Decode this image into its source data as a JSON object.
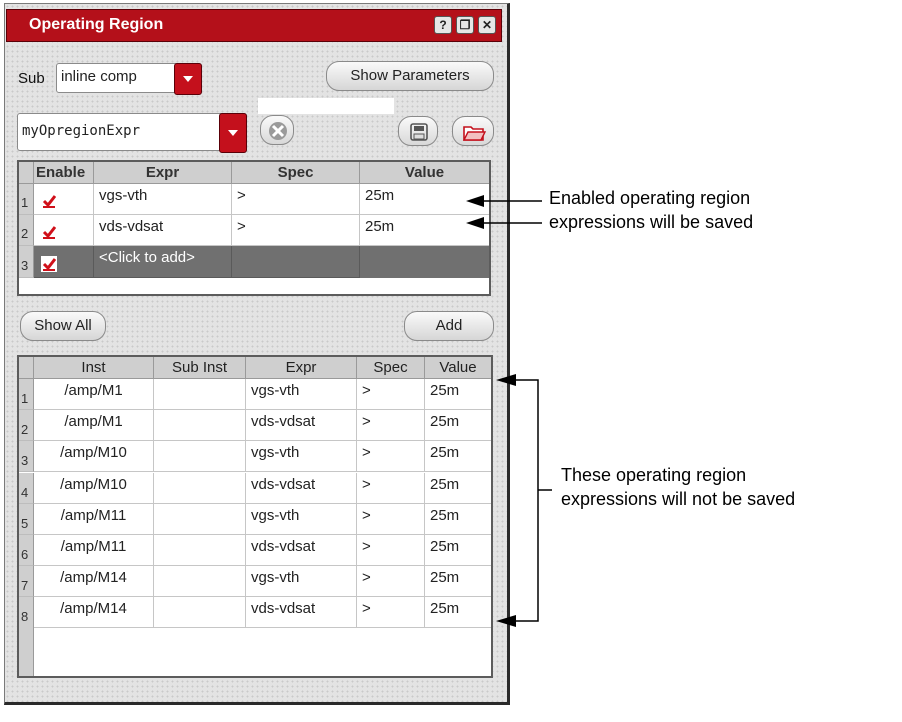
{
  "window": {
    "title": "Operating Region",
    "help_glyph": "?",
    "restore_glyph": "❐",
    "close_glyph": "✕"
  },
  "sub": {
    "label": "Sub",
    "selected": "inline comp"
  },
  "show_parameters_label": "Show Parameters",
  "expr_set_selected": "myOpregionExpr",
  "top_table": {
    "columns": [
      "Enable",
      "Expr",
      "Spec",
      "Value"
    ],
    "rows": [
      {
        "num": "1",
        "enabled": true,
        "expr": "vgs-vth",
        "spec": ">",
        "value": "25m"
      },
      {
        "num": "2",
        "enabled": true,
        "expr": "vds-vdsat",
        "spec": ">",
        "value": "25m"
      },
      {
        "num": "3",
        "enabled": true,
        "expr": "<Click to add>",
        "spec": "",
        "value": ""
      }
    ]
  },
  "show_all_label": "Show All",
  "add_label": "Add",
  "bottom_table": {
    "columns": [
      "Inst",
      "Sub Inst",
      "Expr",
      "Spec",
      "Value"
    ],
    "rows": [
      {
        "num": "1",
        "inst": "/amp/M1",
        "sub_inst": "",
        "expr": "vgs-vth",
        "spec": ">",
        "value": "25m"
      },
      {
        "num": "2",
        "inst": "/amp/M1",
        "sub_inst": "",
        "expr": "vds-vdsat",
        "spec": ">",
        "value": "25m"
      },
      {
        "num": "3",
        "inst": "/amp/M10",
        "sub_inst": "",
        "expr": "vgs-vth",
        "spec": ">",
        "value": "25m"
      },
      {
        "num": "4",
        "inst": "/amp/M10",
        "sub_inst": "",
        "expr": "vds-vdsat",
        "spec": ">",
        "value": "25m"
      },
      {
        "num": "5",
        "inst": "/amp/M11",
        "sub_inst": "",
        "expr": "vgs-vth",
        "spec": ">",
        "value": "25m"
      },
      {
        "num": "6",
        "inst": "/amp/M11",
        "sub_inst": "",
        "expr": "vds-vdsat",
        "spec": ">",
        "value": "25m"
      },
      {
        "num": "7",
        "inst": "/amp/M14",
        "sub_inst": "",
        "expr": "vgs-vth",
        "spec": ">",
        "value": "25m"
      },
      {
        "num": "8",
        "inst": "/amp/M14",
        "sub_inst": "",
        "expr": "vds-vdsat",
        "spec": ">",
        "value": "25m"
      }
    ]
  },
  "annotations": {
    "saved_line1": "Enabled operating region",
    "saved_line2": "expressions will be saved",
    "not_saved_line1": "These operating region",
    "not_saved_line2": "expressions will not be saved"
  },
  "colors": {
    "title_bar": "#b4101a",
    "accent_red": "#c4101c",
    "checkmark": "#d0101a",
    "selected_row": "#707070"
  },
  "icons": {
    "help": "help-icon",
    "restore": "restore-icon",
    "close": "close-icon",
    "clear": "clear-x-icon",
    "save": "floppy-disk-icon",
    "open": "folder-open-icon"
  }
}
